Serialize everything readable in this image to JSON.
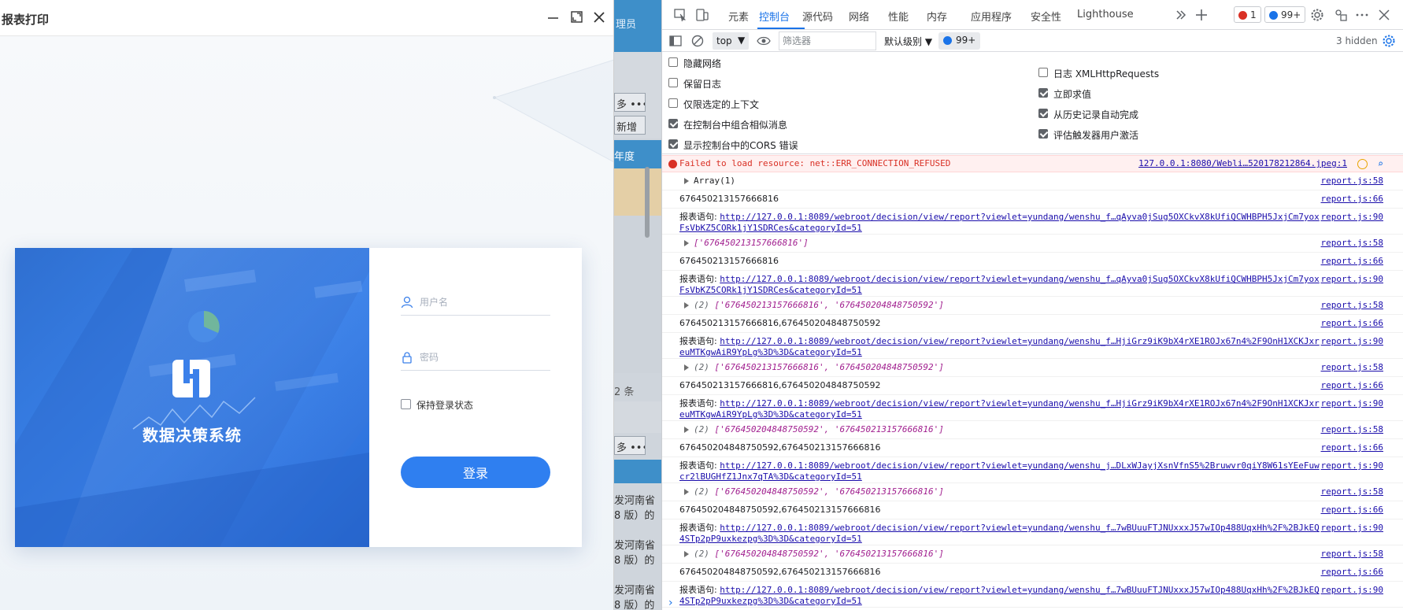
{
  "modal": {
    "title": "报表打印",
    "brand_name": "数据决策系统",
    "username_placeholder": "用户名",
    "password_placeholder": "密码",
    "remember_label": "保持登录状态",
    "login_label": "登录",
    "accent": "#2f7ff0"
  },
  "background_page": {
    "frag_top": "理员",
    "more_1": "多 •••",
    "add": "新增",
    "col": "年度",
    "count": "2 条",
    "more_2": "多 •••",
    "r1a": "发河南省",
    "r1b": "8 版）的",
    "r2a": "发河南省",
    "r2b": "8 版）的",
    "r3a": "发河南省",
    "r3b": "8 版）的"
  },
  "devtools": {
    "tabs": [
      "元素",
      "控制台",
      "源代码",
      "网络",
      "性能",
      "内存",
      "应用程序",
      "安全性",
      "Lighthouse"
    ],
    "active_tab": "控制台",
    "error_badge": "1",
    "issues_badge": "99+",
    "toolbar": {
      "context": "top",
      "filter_placeholder": "筛选器",
      "level": "默认级别",
      "issues": "99+",
      "hidden": "3 hidden"
    },
    "settings_left": [
      {
        "label": "隐藏网络",
        "checked": false
      },
      {
        "label": "保留日志",
        "checked": false
      },
      {
        "label": "仅限选定的上下文",
        "checked": false
      },
      {
        "label": "在控制台中组合相似消息",
        "checked": true
      },
      {
        "label": "显示控制台中的CORS 错误",
        "checked": true
      }
    ],
    "settings_right": [
      {
        "label": "日志 XMLHttpRequests",
        "checked": false
      },
      {
        "label": "立即求值",
        "checked": true
      },
      {
        "label": "从历史记录自动完成",
        "checked": true
      },
      {
        "label": "评估触发器用户激活",
        "checked": true
      }
    ],
    "error_row": {
      "message": "Failed to load resource: net::ERR_CONNECTION_REFUSED",
      "source": "127.0.0.1:8080/Webli…520178212864.jpeg:1"
    },
    "logs": [
      {
        "type": "arr",
        "text": "Array(1)",
        "source": "report.js:58"
      },
      {
        "type": "plain",
        "text": "676450213157666816",
        "source": "report.js:66"
      },
      {
        "type": "url",
        "label": "报表语句: ",
        "url": "http://127.0.0.1:8089/webroot/decision/view/report?viewlet=yundang/wenshu_f…qAyva0jSug5OXCkvX8kUfiQCWHBPH5JxjCm7yoxFsVbKZ5CORk1jY1SDRCes&categoryId=51",
        "source": "report.js:90"
      },
      {
        "type": "arr",
        "text": "['676450213157666816']",
        "source": "report.js:58"
      },
      {
        "type": "plain",
        "text": "676450213157666816",
        "source": "report.js:66"
      },
      {
        "type": "url",
        "label": "报表语句: ",
        "url": "http://127.0.0.1:8089/webroot/decision/view/report?viewlet=yundang/wenshu_f…qAyva0jSug5OXCkvX8kUfiQCWHBPH5JxjCm7yoxFsVbKZ5CORk1jY1SDRCes&categoryId=51",
        "source": "report.js:90"
      },
      {
        "type": "arr",
        "count": "(2) ",
        "text": "['676450213157666816', '676450204848750592']",
        "source": "report.js:58"
      },
      {
        "type": "plain",
        "text": "676450213157666816,676450204848750592",
        "source": "report.js:66"
      },
      {
        "type": "url",
        "label": "报表语句: ",
        "url": "http://127.0.0.1:8089/webroot/decision/view/report?viewlet=yundang/wenshu_f…HjiGrz9iK9bX4rXE1ROJx67n4%2F9OnH1XCKJxreuMTKgwAiR9YpLg%3D%3D&categoryId=51",
        "source": "report.js:90"
      },
      {
        "type": "arr",
        "count": "(2) ",
        "text": "['676450213157666816', '676450204848750592']",
        "source": "report.js:58"
      },
      {
        "type": "plain",
        "text": "676450213157666816,676450204848750592",
        "source": "report.js:66"
      },
      {
        "type": "url",
        "label": "报表语句: ",
        "url": "http://127.0.0.1:8089/webroot/decision/view/report?viewlet=yundang/wenshu_f…HjiGrz9iK9bX4rXE1ROJx67n4%2F9OnH1XCKJxreuMTKgwAiR9YpLg%3D%3D&categoryId=51",
        "source": "report.js:90"
      },
      {
        "type": "arr",
        "count": "(2) ",
        "text": "['676450204848750592', '676450213157666816']",
        "source": "report.js:58"
      },
      {
        "type": "plain",
        "text": "676450204848750592,676450213157666816",
        "source": "report.js:66"
      },
      {
        "type": "url",
        "label": "报表语句: ",
        "url": "http://127.0.0.1:8089/webroot/decision/view/report?viewlet=yundang/wenshu_j…DLxWJayjXsnVfnS5%2Bruwvr0qiY8W61sYEeFuwcr2lBUGHfZ1Jnx7qTA%3D&categoryId=51",
        "source": "report.js:90"
      },
      {
        "type": "arr",
        "count": "(2) ",
        "text": "['676450204848750592', '676450213157666816']",
        "source": "report.js:58"
      },
      {
        "type": "plain",
        "text": "676450204848750592,676450213157666816",
        "source": "report.js:66"
      },
      {
        "type": "url",
        "label": "报表语句: ",
        "url": "http://127.0.0.1:8089/webroot/decision/view/report?viewlet=yundang/wenshu_f…7wBUuuFTJNUxxxJ57wIOp488UqxHh%2F%2BJkEQ4STp2pP9uxkezpg%3D%3D&categoryId=51",
        "source": "report.js:90"
      },
      {
        "type": "arr",
        "count": "(2) ",
        "text": "['676450204848750592', '676450213157666816']",
        "source": "report.js:58"
      },
      {
        "type": "plain",
        "text": "676450204848750592,676450213157666816",
        "source": "report.js:66"
      },
      {
        "type": "url",
        "label": "报表语句: ",
        "url": "http://127.0.0.1:8089/webroot/decision/view/report?viewlet=yundang/wenshu_f…7wBUuuFTJNUxxxJ57wIOp488UqxHh%2F%2BJkEQ4STp2pP9uxkezpg%3D%3D&categoryId=51",
        "source": "report.js:90"
      }
    ],
    "prompt": "›"
  }
}
